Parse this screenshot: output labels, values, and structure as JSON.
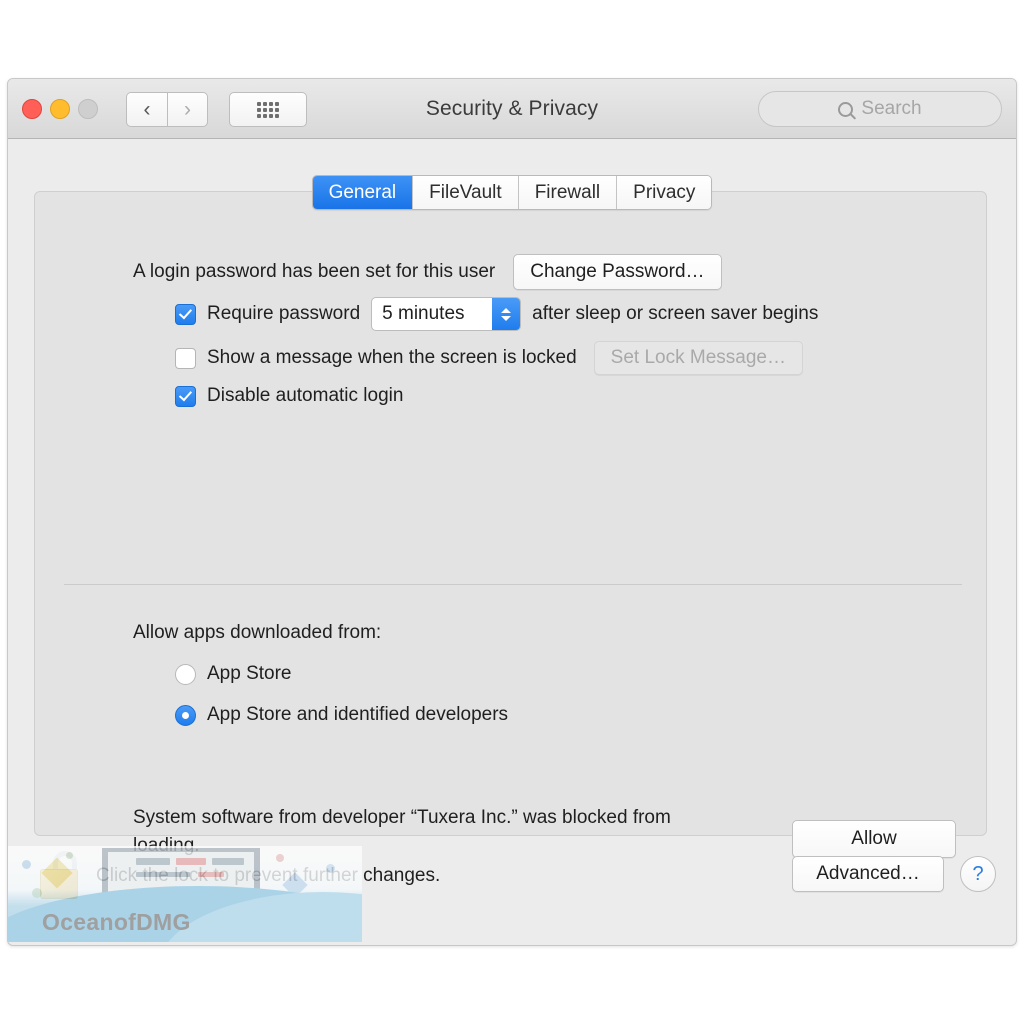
{
  "window": {
    "title": "Security & Privacy",
    "traffic_lights": [
      "close-button",
      "minimize-button",
      "zoom-button"
    ],
    "back_arrow": "‹",
    "forward_arrow": "›",
    "grid_icon": "show-all-icon",
    "search": {
      "placeholder": "Search",
      "value": "",
      "icon": "search-icon"
    }
  },
  "tabs": [
    {
      "label": "General",
      "active": true
    },
    {
      "label": "FileVault",
      "active": false
    },
    {
      "label": "Firewall",
      "active": false
    },
    {
      "label": "Privacy",
      "active": false
    }
  ],
  "general": {
    "login_password_text": "A login password has been set for this user",
    "change_password_button": "Change Password…",
    "require_password": {
      "checked": true,
      "label_before": "Require password",
      "interval_value": "5 minutes",
      "label_after": "after sleep or screen saver begins"
    },
    "show_message": {
      "checked": false,
      "label": "Show a message when the screen is locked",
      "button": "Set Lock Message…",
      "button_disabled": true
    },
    "disable_auto_login": {
      "checked": true,
      "label": "Disable automatic login"
    },
    "allow_apps_heading": "Allow apps downloaded from:",
    "allow_apps_options": [
      {
        "label": "App Store",
        "selected": false
      },
      {
        "label": "App Store and identified developers",
        "selected": true
      }
    ],
    "blocked_notice": "System software from developer “Tuxera Inc.” was blocked from loading.",
    "allow_button": "Allow"
  },
  "footer": {
    "lock_icon": "unlocked-padlock-icon",
    "lock_message": "Click the lock to prevent further changes.",
    "advanced_button": "Advanced…",
    "help_button": "?"
  },
  "watermark": {
    "text": "OceanofDMG"
  },
  "colors": {
    "accent_blue": "#1f7ded",
    "tab_active_blue": "#2f86f0",
    "window_bg": "#ececec",
    "panel_bg": "#e3e3e3",
    "text": "#1f1f1f",
    "disabled_text": "#a9a9a9",
    "help_blue": "#2a7de1"
  }
}
